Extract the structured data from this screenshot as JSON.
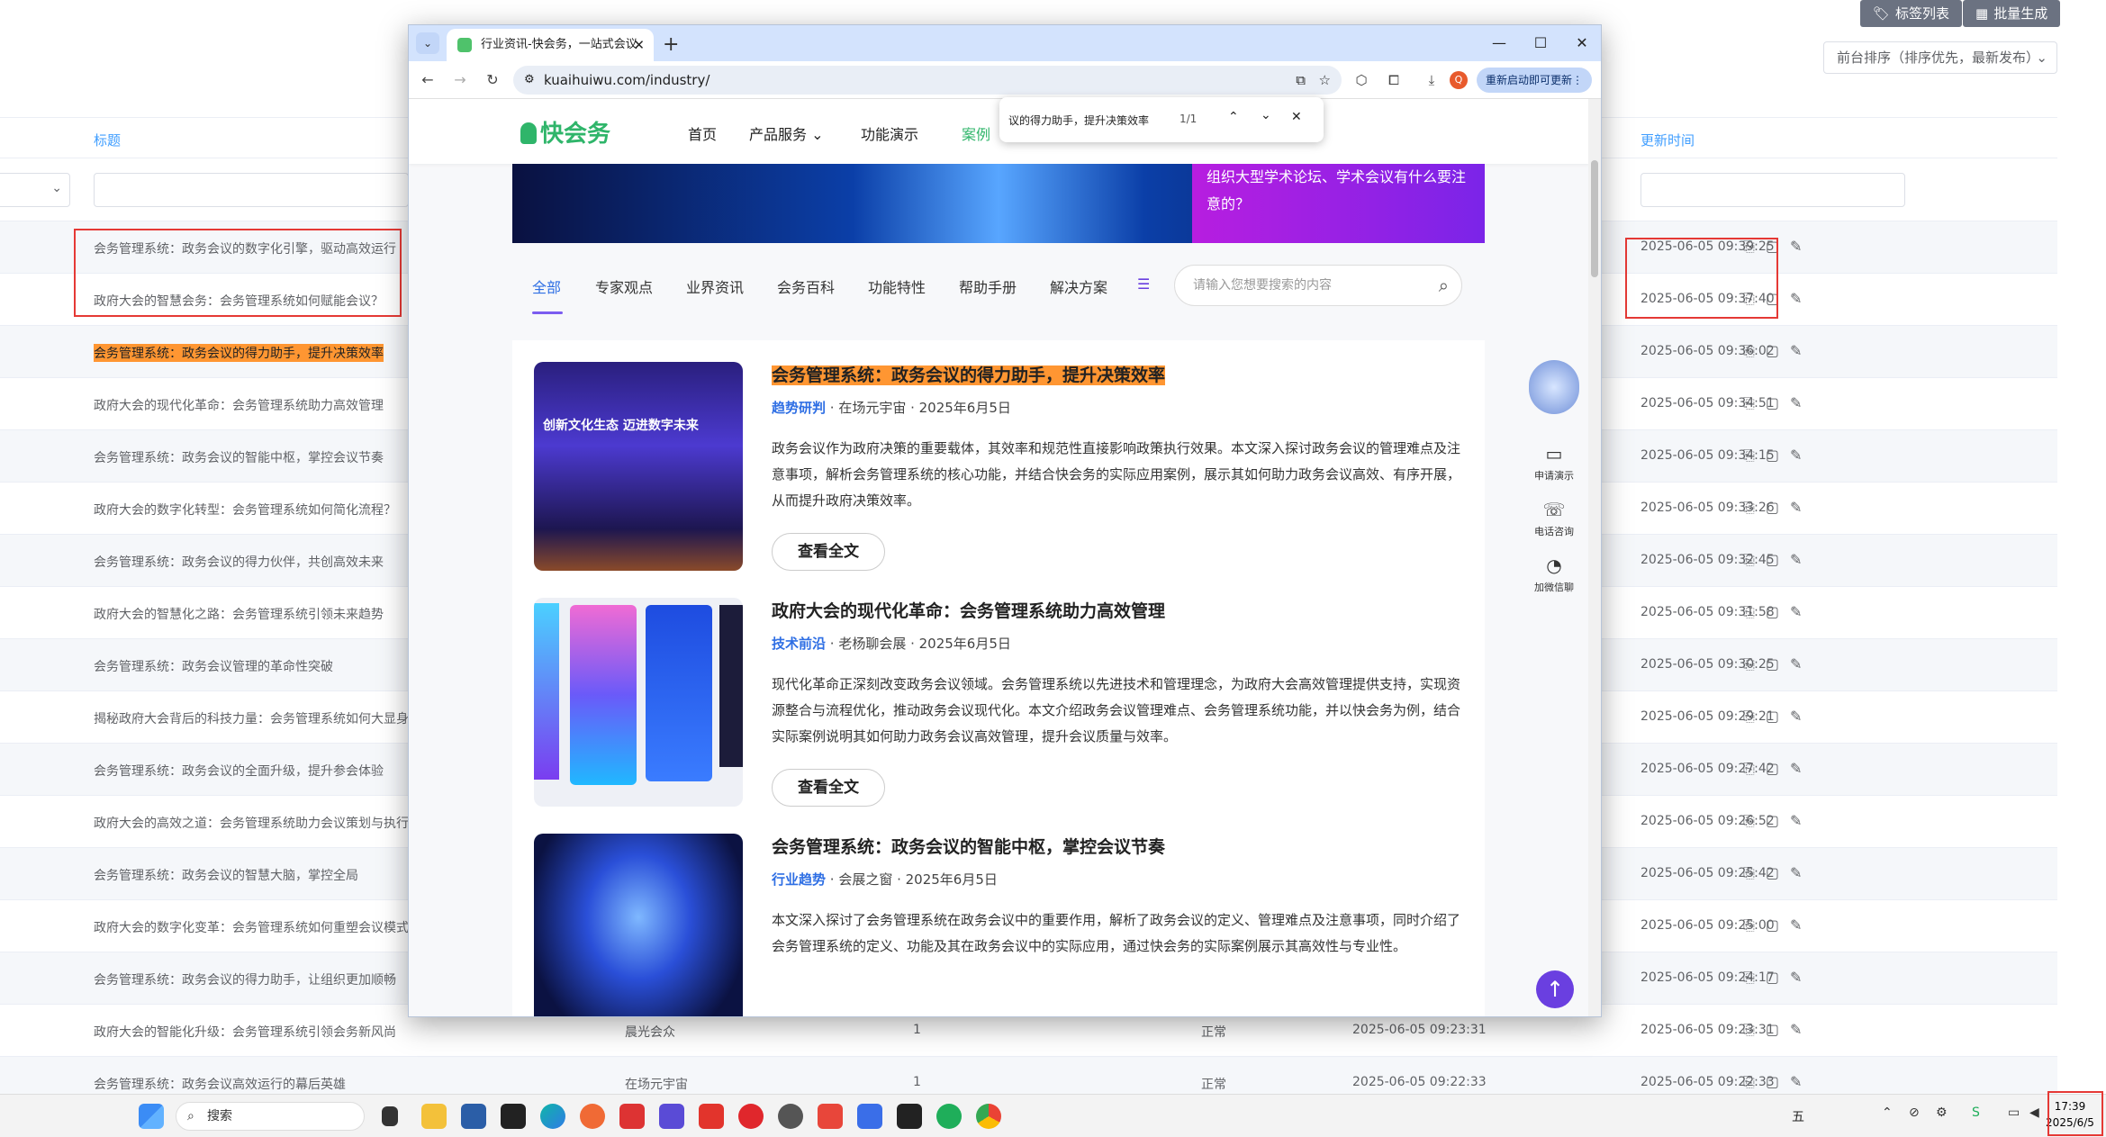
{
  "admin": {
    "tag_list_label": "标签列表",
    "batch_label": "批量生成",
    "sort_value": "前台排序（排序优先，最新发布）",
    "col_title": "标题",
    "col_updated": "更新时间",
    "rows": [
      {
        "title": "会务管理系统：政务会议的数字化引擎，驱动高效运行",
        "author": "",
        "count": "",
        "status": "",
        "created": "",
        "updated": "2025-06-05 09:39:25"
      },
      {
        "title": "政府大会的智慧会务：会务管理系统如何赋能会议？",
        "author": "",
        "count": "",
        "status": "",
        "created": "",
        "updated": "2025-06-05 09:37:40"
      },
      {
        "title": "会务管理系统：政务会议的得力助手，提升决策效率",
        "author": "",
        "count": "",
        "status": "",
        "created": "",
        "updated": "2025-06-05 09:36:02"
      },
      {
        "title": "政府大会的现代化革命：会务管理系统助力高效管理",
        "author": "",
        "count": "",
        "status": "",
        "created": "",
        "updated": "2025-06-05 09:34:51"
      },
      {
        "title": "会务管理系统：政务会议的智能中枢，掌控会议节奏",
        "author": "",
        "count": "",
        "status": "",
        "created": "",
        "updated": "2025-06-05 09:34:15"
      },
      {
        "title": "政府大会的数字化转型：会务管理系统如何简化流程？",
        "author": "",
        "count": "",
        "status": "",
        "created": "",
        "updated": "2025-06-05 09:33:26"
      },
      {
        "title": "会务管理系统：政务会议的得力伙伴，共创高效未来",
        "author": "",
        "count": "",
        "status": "",
        "created": "",
        "updated": "2025-06-05 09:32:45"
      },
      {
        "title": "政府大会的智慧化之路：会务管理系统引领未来趋势",
        "author": "",
        "count": "",
        "status": "",
        "created": "",
        "updated": "2025-06-05 09:31:58"
      },
      {
        "title": "会务管理系统：政务会议管理的革命性突破",
        "author": "",
        "count": "",
        "status": "",
        "created": "",
        "updated": "2025-06-05 09:30:25"
      },
      {
        "title": "揭秘政府大会背后的科技力量：会务管理系统如何大显身",
        "author": "",
        "count": "",
        "status": "",
        "created": "",
        "updated": "2025-06-05 09:29:21"
      },
      {
        "title": "会务管理系统：政务会议的全面升级，提升参会体验",
        "author": "",
        "count": "",
        "status": "",
        "created": "",
        "updated": "2025-06-05 09:27:42"
      },
      {
        "title": "政府大会的高效之道：会务管理系统助力会议策划与执行",
        "author": "",
        "count": "",
        "status": "",
        "created": "",
        "updated": "2025-06-05 09:26:52"
      },
      {
        "title": "会务管理系统：政务会议的智慧大脑，掌控全局",
        "author": "",
        "count": "",
        "status": "",
        "created": "",
        "updated": "2025-06-05 09:25:42"
      },
      {
        "title": "政府大会的数字化变革：会务管理系统如何重塑会议模式",
        "author": "",
        "count": "",
        "status": "",
        "created": "",
        "updated": "2025-06-05 09:25:00"
      },
      {
        "title": "会务管理系统：政务会议的得力助手，让组织更加顺畅",
        "author": "",
        "count": "",
        "status": "",
        "created": "",
        "updated": "2025-06-05 09:24:17"
      },
      {
        "title": "政府大会的智能化升级：会务管理系统引领会务新风尚",
        "author": "晨光会众",
        "count": "1",
        "status": "正常",
        "created": "2025-06-05 09:23:31",
        "updated": "2025-06-05 09:23:31"
      },
      {
        "title": "会务管理系统：政务会议高效运行的幕后英雄",
        "author": "在场元宇宙",
        "count": "1",
        "status": "正常",
        "created": "2025-06-05 09:22:33",
        "updated": "2025-06-05 09:22:33"
      }
    ]
  },
  "taskbar": {
    "search_label": "搜索",
    "time": "17:39",
    "date": "2025/6/5",
    "ime": "五"
  },
  "browser": {
    "tab_title": "行业资讯-快会务，一站式会议",
    "url": "kuaihuiwu.com/industry/",
    "relaunch_label": "重新启动即可更新",
    "find_query": "议的得力助手，提升决策效率",
    "find_count": "1/1"
  },
  "site": {
    "logo": "快会务",
    "nav": [
      "首页",
      "产品服务",
      "功能演示",
      "案例"
    ],
    "banner_text": "组织大型学术论坛、学术会议有什么要注意的？",
    "categories": [
      "全部",
      "专家观点",
      "业界资讯",
      "会务百科",
      "功能特性",
      "帮助手册",
      "解决方案"
    ],
    "search_placeholder": "请输入您想要搜索的内容",
    "articles": [
      {
        "title": "会务管理系统：政务会议的得力助手，提升决策效率",
        "tag": "趋势研判",
        "meta": " · 在场元宇宙 · 2025年6月5日",
        "desc": "政务会议作为政府决策的重要载体，其效率和规范性直接影响政策执行效果。本文深入探讨政务会议的管理难点及注意事项，解析会务管理系统的核心功能，并结合快会务的实际应用案例，展示其如何助力政务会议高效、有序开展，从而提升政府决策效率。",
        "more": "查看全文",
        "thumb_text": "创新文化生态 迈进数字未来"
      },
      {
        "title": "政府大会的现代化革命：会务管理系统助力高效管理",
        "tag": "技术前沿",
        "meta": " · 老杨聊会展 · 2025年6月5日",
        "desc": "现代化革命正深刻改变政务会议领域。会务管理系统以先进技术和管理理念，为政府大会高效管理提供支持，实现资源整合与流程优化，推动政务会议现代化。本文介绍政务会议管理难点、会务管理系统功能，并以快会务为例，结合实际案例说明其如何助力政务会议高效管理，提升会议质量与效率。",
        "more": "查看全文"
      },
      {
        "title": "会务管理系统：政务会议的智能中枢，掌控会议节奏",
        "tag": "行业趋势",
        "meta": " · 会展之窗 · 2025年6月5日",
        "desc": "本文深入探讨了会务管理系统在政务会议中的重要作用，解析了政务会议的定义、管理难点及注意事项，同时介绍了会务管理系统的定义、功能及其在政务会议中的实际应用，通过快会务的实际案例展示其高效性与专业性。",
        "more": "查看全文"
      }
    ],
    "float": [
      "申请演示",
      "电话咨询",
      "加微信聊"
    ]
  }
}
